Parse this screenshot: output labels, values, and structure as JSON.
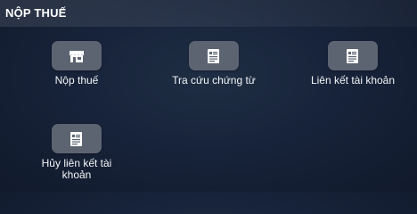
{
  "section": {
    "title": "NỘP THUẾ"
  },
  "tiles": [
    {
      "label": "Nộp thuế",
      "icon": "shop-icon"
    },
    {
      "label": "Tra cứu chứng từ",
      "icon": "document-icon"
    },
    {
      "label": "Liên kết tài khoản",
      "icon": "document-icon"
    },
    {
      "label": "Hủy liên kết tài khoản",
      "icon": "document-icon"
    }
  ],
  "colors": {
    "background": "#17233a",
    "tile_bg": "#5c6472",
    "text": "#ffffff"
  }
}
